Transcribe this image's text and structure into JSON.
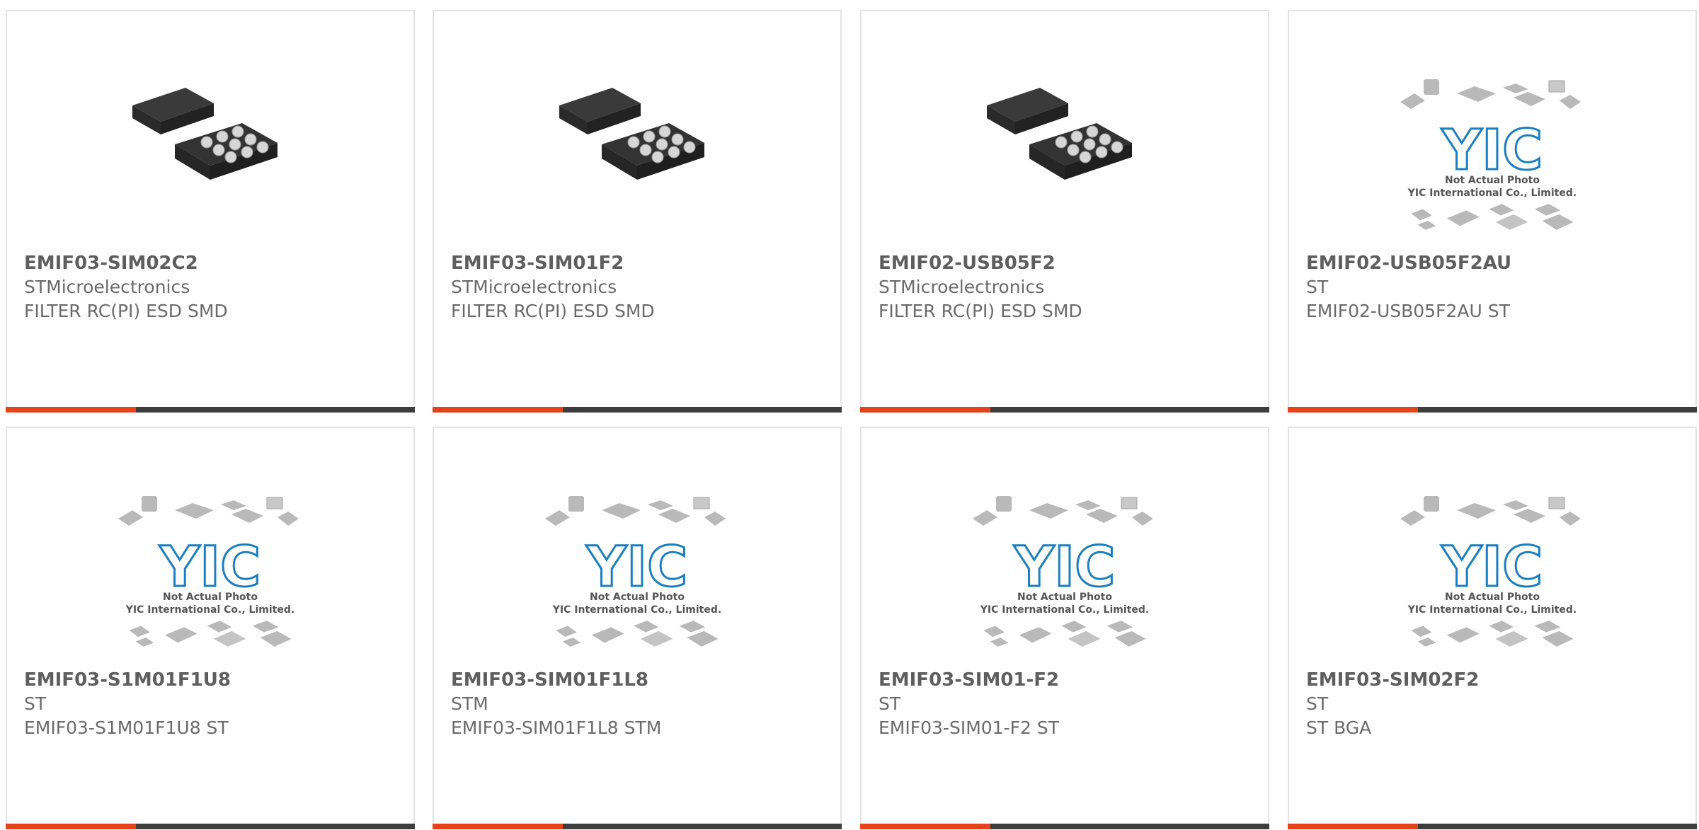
{
  "colors": {
    "accent": "#e8421b",
    "bar": "#3d3d3d",
    "border": "#e3e3e3",
    "text": "#666666",
    "logo": "#1a7fc1"
  },
  "products": [
    {
      "part_number": "EMIF03-SIM02C2",
      "manufacturer": "STMicroelectronics",
      "description": "FILTER RC(PI) ESD SMD",
      "image": "bga-chip-photo"
    },
    {
      "part_number": "EMIF03-SIM01F2",
      "manufacturer": "STMicroelectronics",
      "description": "FILTER RC(PI) ESD SMD",
      "image": "bga-chip-photo"
    },
    {
      "part_number": "EMIF02-USB05F2",
      "manufacturer": "STMicroelectronics",
      "description": "FILTER RC(PI) ESD SMD",
      "image": "bga-chip-photo"
    },
    {
      "part_number": "EMIF02-USB05F2AU",
      "manufacturer": "ST",
      "description": "EMIF02-USB05F2AU ST",
      "image": "not-actual-photo"
    },
    {
      "part_number": "EMIF03-S1M01F1U8",
      "manufacturer": "ST",
      "description": "EMIF03-S1M01F1U8 ST",
      "image": "not-actual-photo"
    },
    {
      "part_number": "EMIF03-SIM01F1L8",
      "manufacturer": "STM",
      "description": "EMIF03-SIM01F1L8 STM",
      "image": "not-actual-photo"
    },
    {
      "part_number": "EMIF03-SIM01-F2",
      "manufacturer": "ST",
      "description": "EMIF03-SIM01-F2 ST",
      "image": "not-actual-photo"
    },
    {
      "part_number": "EMIF03-SIM02F2",
      "manufacturer": "ST",
      "description": "ST BGA",
      "image": "not-actual-photo"
    }
  ],
  "placeholder": {
    "logo_text": "YIC",
    "line1": "Not Actual Photo",
    "line2": "YIC International Co., Limited."
  }
}
